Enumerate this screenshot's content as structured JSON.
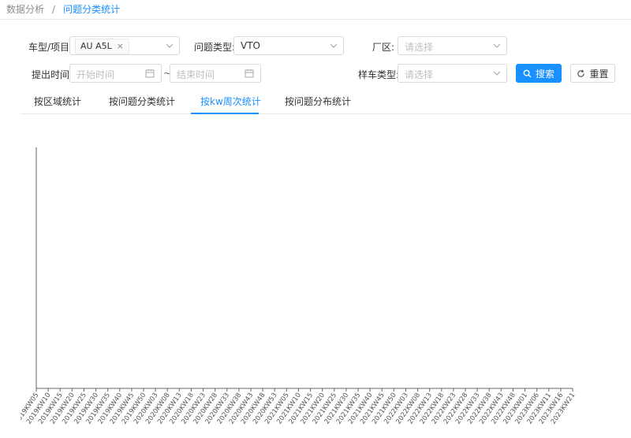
{
  "breadcrumb": {
    "root": "数据分析",
    "separator": "/",
    "current": "问题分类统计"
  },
  "filters": {
    "vehicle_label": "车型/项目:",
    "vehicle_tag": "AU A5L",
    "issue_type_label": "问题类型:",
    "issue_type_value": "VTO",
    "plant_label": "厂区:",
    "plant_placeholder": "请选择",
    "submit_time_label": "提出时间:",
    "start_placeholder": "开始时间",
    "range_sep": "~",
    "end_placeholder": "结束时间",
    "sample_type_label": "样车类型:",
    "sample_type_placeholder": "请选择",
    "search_label": "搜索",
    "reset_label": "重置"
  },
  "tabs": [
    {
      "label": "按区域统计",
      "active": false
    },
    {
      "label": "按问题分类统计",
      "active": false
    },
    {
      "label": "按kw周次统计",
      "active": true
    },
    {
      "label": "按问题分布统计",
      "active": false
    }
  ],
  "colors": {
    "accent": "#1890ff",
    "axis": "#666666"
  },
  "chart_data": {
    "type": "bar",
    "title": "",
    "xlabel": "",
    "ylabel": "",
    "categories": [
      "2019KW05",
      "2019KW10",
      "2019KW15",
      "2019KW20",
      "2019KW25",
      "2019KW30",
      "2019KW35",
      "2019KW40",
      "2019KW45",
      "2019KW50",
      "2020KW03",
      "2020KW08",
      "2020KW13",
      "2020KW18",
      "2020KW23",
      "2020KW28",
      "2020KW33",
      "2020KW38",
      "2020KW43",
      "2020KW48",
      "2020KW53",
      "2021KW05",
      "2021KW10",
      "2021KW15",
      "2021KW20",
      "2021KW25",
      "2021KW30",
      "2021KW35",
      "2021KW40",
      "2021KW45",
      "2021KW50",
      "2022KW03",
      "2022KW08",
      "2022KW13",
      "2022KW18",
      "2022KW23",
      "2022KW28",
      "2022KW33",
      "2022KW38",
      "2022KW43",
      "2022KW48",
      "2023KW01",
      "2023KW06",
      "2023KW11",
      "2023KW16",
      "2023KW21"
    ],
    "series": [
      {
        "values": []
      }
    ],
    "grid": false,
    "legend": "none"
  }
}
